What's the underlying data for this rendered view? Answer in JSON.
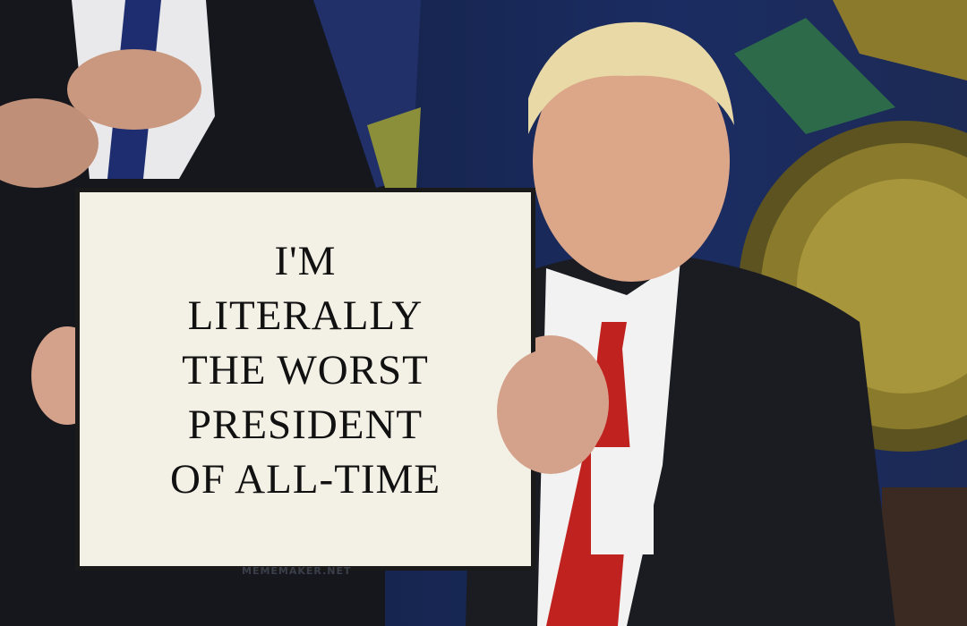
{
  "sign": {
    "lines": [
      "I'M",
      "LITERALLY",
      "THE WORST",
      "PRESIDENT",
      "OF ALL-TIME"
    ]
  },
  "watermark": "MEMEMAKER.NET",
  "colors": {
    "sign": "#f3f1e6",
    "tie": "#c0221f",
    "suit": "#1a1c22",
    "emblem": "#8a7a2c",
    "background": "#16254f"
  }
}
